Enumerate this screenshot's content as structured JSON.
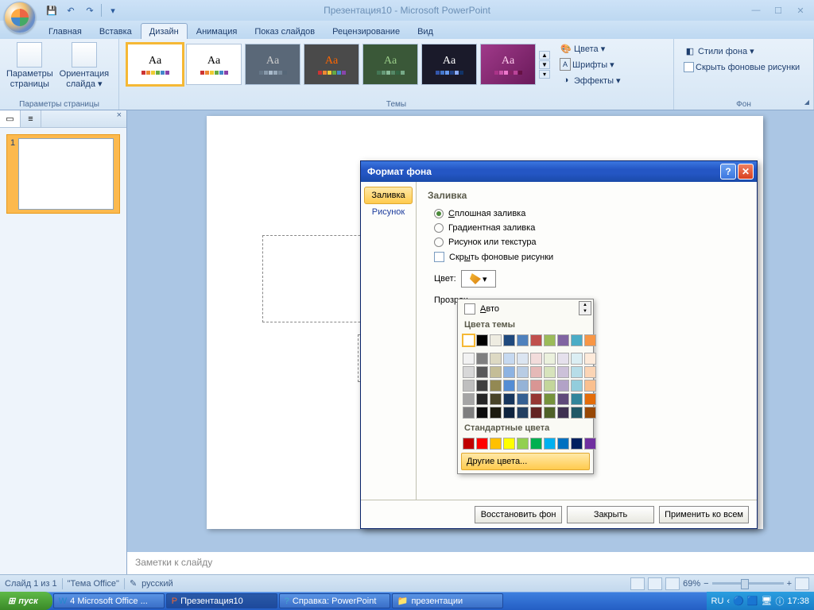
{
  "title": "Презентация10 - Microsoft PowerPoint",
  "qat": {
    "save": "💾",
    "undo": "↶",
    "redo": "↷"
  },
  "tabs": [
    "Главная",
    "Вставка",
    "Дизайн",
    "Анимация",
    "Показ слайдов",
    "Рецензирование",
    "Вид"
  ],
  "active_tab_index": 2,
  "ribbon": {
    "group_params": "Параметры страницы",
    "btn_page_params": "Параметры\nстраницы",
    "btn_orientation": "Ориентация\nслайда ▾",
    "group_themes": "Темы",
    "group_bg": "Фон",
    "colors": "Цвета ▾",
    "fonts": "Шрифты ▾",
    "effects": "Эффекты ▾",
    "bg_styles": "Стили фона ▾",
    "hide_bg": "Скрыть фоновые рисунки"
  },
  "themes_aa": "Aa",
  "notes_placeholder": "Заметки к слайду",
  "status": {
    "slide": "Слайд 1 из 1",
    "theme": "\"Тема Office\"",
    "lang": "русский",
    "zoom": "69%"
  },
  "taskbar": {
    "start": "пуск",
    "items": [
      "4 Microsoft Office ...",
      "Презентация10",
      "Справка: PowerPoint",
      "презентации"
    ],
    "lang": "RU",
    "time": "17:38"
  },
  "dialog": {
    "title": "Формат фона",
    "nav": [
      "Заливка",
      "Рисунок"
    ],
    "heading": "Заливка",
    "r_solid": "Сплошная заливка",
    "r_gradient": "Градиентная заливка",
    "r_picture": "Рисунок или текстура",
    "chk_hide": "Скрыть фоновые рисунки",
    "lbl_color": "Цвет:",
    "lbl_transp": "Прозрач",
    "btn_restore": "Восстановить фон",
    "btn_close": "Закрыть",
    "btn_apply": "Применить ко всем"
  },
  "color_popup": {
    "auto": "Авто",
    "theme_header": "Цвета темы",
    "std_header": "Стандартные цвета",
    "more": "Другие цвета...",
    "theme_row1": [
      "#ffffff",
      "#000000",
      "#eeece1",
      "#1f497d",
      "#4f81bd",
      "#c0504d",
      "#9bbb59",
      "#8064a2",
      "#4bacc6",
      "#f79646"
    ],
    "theme_shades": [
      [
        "#f2f2f2",
        "#7f7f7f",
        "#ddd9c3",
        "#c6d9f0",
        "#dbe5f1",
        "#f2dcdb",
        "#ebf1dd",
        "#e5e0ec",
        "#dbeef3",
        "#fdeada"
      ],
      [
        "#d8d8d8",
        "#595959",
        "#c4bd97",
        "#8db3e2",
        "#b8cce4",
        "#e5b9b7",
        "#d7e3bc",
        "#ccc1d9",
        "#b7dde8",
        "#fbd5b5"
      ],
      [
        "#bfbfbf",
        "#3f3f3f",
        "#938953",
        "#548dd4",
        "#95b3d7",
        "#d99694",
        "#c3d69b",
        "#b2a2c7",
        "#92cddc",
        "#fac08f"
      ],
      [
        "#a5a5a5",
        "#262626",
        "#494429",
        "#17365d",
        "#366092",
        "#953734",
        "#76923c",
        "#5f497a",
        "#31859b",
        "#e36c09"
      ],
      [
        "#7f7f7f",
        "#0c0c0c",
        "#1d1b10",
        "#0f243e",
        "#244061",
        "#632423",
        "#4f6128",
        "#3f3151",
        "#205867",
        "#974806"
      ]
    ],
    "standard": [
      "#c00000",
      "#ff0000",
      "#ffc000",
      "#ffff00",
      "#92d050",
      "#00b050",
      "#00b0f0",
      "#0070c0",
      "#002060",
      "#7030a0"
    ]
  }
}
